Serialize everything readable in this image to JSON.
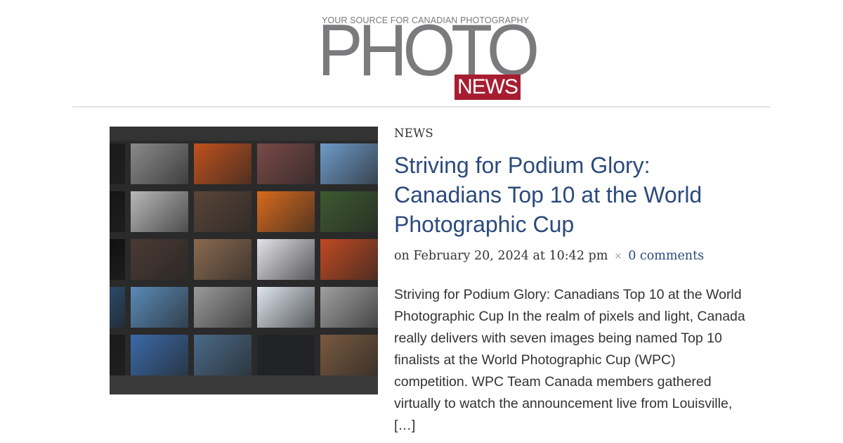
{
  "logo": {
    "tagline": "YOUR SOURCE FOR CANADIAN PHOTOGRAPHY",
    "word": "PHOTO",
    "badge": "NEWS",
    "colors": {
      "word": "#7b7b7d",
      "badge": "#a71d31"
    }
  },
  "post": {
    "category": "NEWS",
    "title": "Striving for Podium Glory: Canadians Top 10 at the World Photographic Cup",
    "meta": {
      "date": "on February 20, 2024 at 10:42 pm",
      "separator": "×",
      "comments": "0 comments"
    },
    "excerpt": "Striving for Podium Glory: Canadians Top 10 at the World Photographic Cup In the realm of pixels and light, Canada really delivers with seven images being named Top 10 finalists at the World Photographic Cup (WPC) competition. WPC Team Canada members gathered virtually to watch the announcement live from Louisville, […]",
    "thumbnail": {
      "alt_icon": "photo-grid-image",
      "tiles": [
        [
          "#1a1a1a",
          "#8a8a8a",
          "#c0521e",
          "#7a4a48",
          "#6e9bc8"
        ],
        [
          "#151515",
          "#b8b8b8",
          "#5a4538",
          "#d86a1e",
          "#3c5a30"
        ],
        [
          "#101010",
          "#4a3a34",
          "#8a6a50",
          "#e2e2e8",
          "#c04a22"
        ],
        [
          "#2a4a6a",
          "#5a8ab8",
          "#9a9a9a",
          "#dfe6f0",
          "#a0a0a0"
        ],
        [
          "#1a1a1a",
          "#3a6aa8",
          "#4a6a88",
          "#202428",
          "#7a5a40"
        ]
      ],
      "colors": {
        "accent": "#2b4a7c",
        "text": "#333333"
      }
    }
  }
}
